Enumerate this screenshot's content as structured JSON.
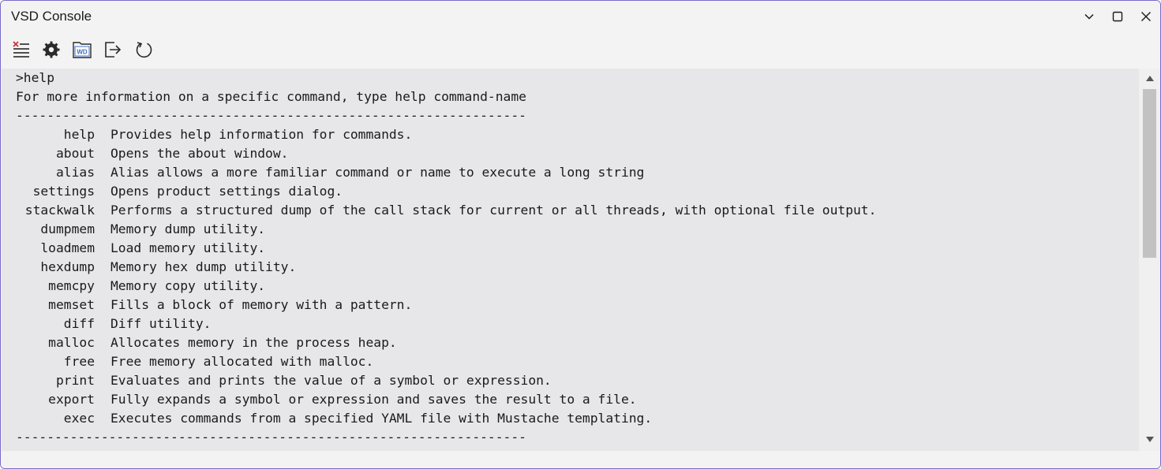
{
  "window": {
    "title": "VSD Console"
  },
  "toolbar": {
    "buttons": [
      {
        "icon": "clear-console-icon"
      },
      {
        "icon": "gear-icon"
      },
      {
        "icon": "wd-folder-icon",
        "text": "WD"
      },
      {
        "icon": "export-icon"
      },
      {
        "icon": "refresh-icon"
      }
    ]
  },
  "console": {
    "prompt_line": ">help",
    "intro": "For more information on a specific command, type help command-name",
    "separator": "------------------------------------------------------------------",
    "commands": [
      {
        "name": "help",
        "desc": "Provides help information for commands."
      },
      {
        "name": "about",
        "desc": "Opens the about window."
      },
      {
        "name": "alias",
        "desc": "Alias allows a more familiar command or name to execute a long string"
      },
      {
        "name": "settings",
        "desc": "Opens product settings dialog."
      },
      {
        "name": "stackwalk",
        "desc": "Performs a structured dump of the call stack for current or all threads, with optional file output."
      },
      {
        "name": "dumpmem",
        "desc": "Memory dump utility."
      },
      {
        "name": "loadmem",
        "desc": "Load memory utility."
      },
      {
        "name": "hexdump",
        "desc": "Memory hex dump utility."
      },
      {
        "name": "memcpy",
        "desc": "Memory copy utility."
      },
      {
        "name": "memset",
        "desc": "Fills a block of memory with a pattern."
      },
      {
        "name": "diff",
        "desc": "Diff utility."
      },
      {
        "name": "malloc",
        "desc": "Allocates memory in the process heap."
      },
      {
        "name": "free",
        "desc": "Free memory allocated with malloc."
      },
      {
        "name": "print",
        "desc": "Evaluates and prints the value of a symbol or expression."
      },
      {
        "name": "export",
        "desc": "Fully expands a symbol or expression and saves the result to a file."
      },
      {
        "name": "exec",
        "desc": "Executes commands from a specified YAML file with Mustache templating."
      }
    ],
    "trailing_prompt": ">"
  },
  "colors": {
    "console_bg": "#e7e7e9",
    "window_border": "#7a6bc9",
    "clear_icon_x": "#d32f2f",
    "wd_icon_blue": "#3b6fc7"
  }
}
